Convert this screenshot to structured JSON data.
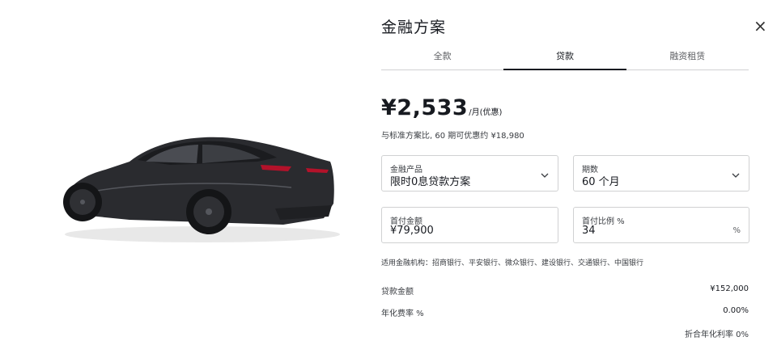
{
  "title": "金融方案",
  "close_label": "×",
  "tabs": [
    {
      "label": "全款",
      "active": false
    },
    {
      "label": "贷款",
      "active": true
    },
    {
      "label": "融资租赁",
      "active": false
    }
  ],
  "price": {
    "amount": "¥2,533",
    "unit": "/月(优惠)"
  },
  "saving_text": "与标准方案比, 60 期可优惠约 ¥18,980",
  "fields": {
    "product": {
      "label": "金融产品",
      "value": "限时0息贷款方案"
    },
    "term": {
      "label": "期数",
      "value": "60 个月"
    },
    "down_amount": {
      "label": "首付金额",
      "value": "¥79,900"
    },
    "down_ratio": {
      "label": "首付比例 %",
      "value": "34",
      "suffix": "%"
    }
  },
  "banks_note": "适用金融机构：招商银行、平安银行、微众银行、建设银行、交通银行、中国银行",
  "summary": [
    {
      "label": "贷款金额",
      "value": "¥152,000"
    },
    {
      "label": "年化费率 %",
      "value": "0.00%"
    }
  ],
  "apr_note": "折合年化利率 0%",
  "colors": {
    "text": "#171a20",
    "border": "#d0d1d2",
    "car": "#2a2b2f",
    "taillight": "#b3122a"
  }
}
